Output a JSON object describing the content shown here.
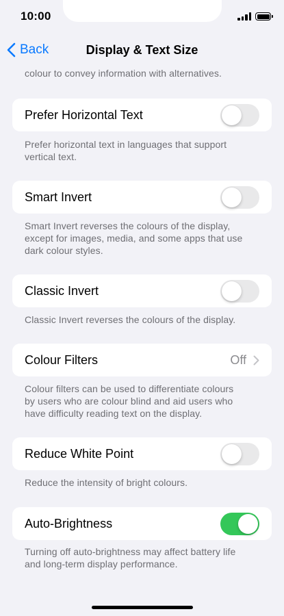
{
  "status_bar": {
    "time": "10:00",
    "signal_icon": "cellular-signal-icon",
    "battery_icon": "battery-full-icon"
  },
  "nav": {
    "back_label": "Back",
    "title": "Display & Text Size",
    "back_icon": "chevron-left-icon"
  },
  "top_footnote": "colour to convey information with alternatives.",
  "rows": [
    {
      "label": "Prefer Horizontal Text",
      "toggle_on": false,
      "footnote_lines": [
        "Prefer horizontal text in languages that support",
        "vertical text."
      ]
    },
    {
      "label": "Smart Invert",
      "toggle_on": false,
      "footnote_lines": [
        "Smart Invert reverses the colours of the display,",
        "except for images, media, and some apps that use",
        "dark colour styles."
      ]
    },
    {
      "label": "Classic Invert",
      "toggle_on": false,
      "footnote_lines": [
        "Classic Invert reverses the colours of the display."
      ]
    },
    {
      "label": "Colour Filters",
      "value": "Off",
      "footnote_lines": [
        "Colour filters can be used to differentiate colours",
        "by users who are colour blind and aid users who",
        "have difficulty reading text on the display."
      ]
    },
    {
      "label": "Reduce White Point",
      "toggle_on": false,
      "footnote_lines": [
        "Reduce the intensity of bright colours."
      ]
    },
    {
      "label": "Auto-Brightness",
      "toggle_on": true,
      "footnote_lines": [
        "Turning off auto-brightness may affect battery life",
        "and long-term display performance."
      ]
    }
  ],
  "colors": {
    "accent": "#0a7aff",
    "toggle_on": "#34c759",
    "toggle_off": "#e9e9ea",
    "background": "#f2f2f7",
    "footnote": "#6e6e73"
  }
}
